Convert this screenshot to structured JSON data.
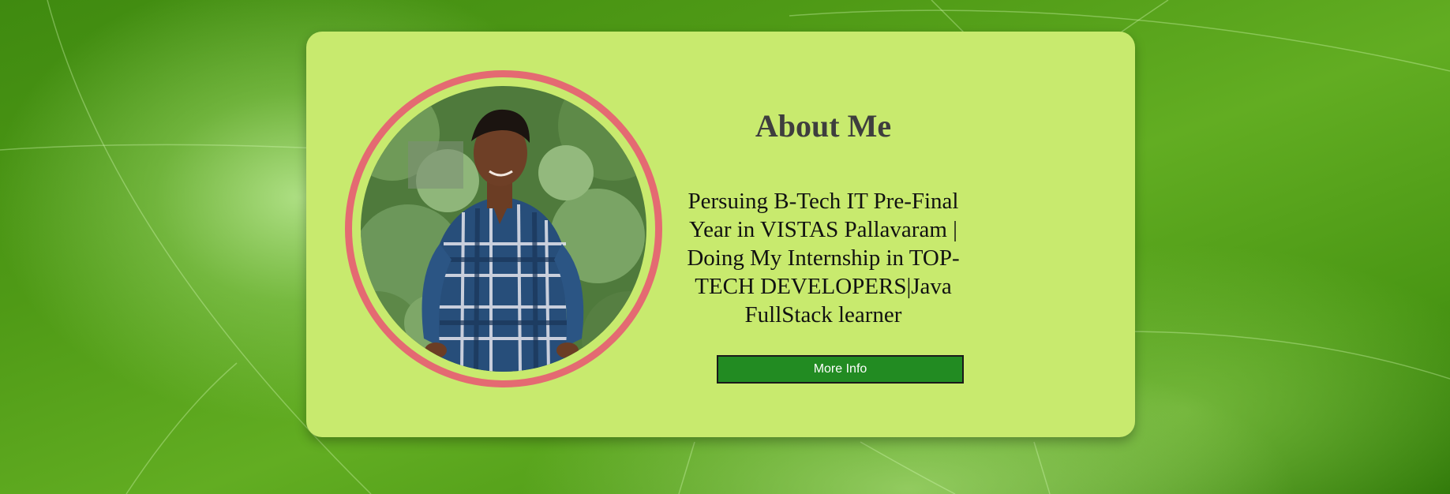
{
  "about": {
    "title": "About Me",
    "bio": "Persuing B-Tech IT Pre-Final Year in VISTAS Pallavaram | Doing My Internship in TOP-TECH DEVELOPERS|Java FullStack learner",
    "more_button_label": "More Info"
  },
  "profile_photo": {
    "icon": "profile-photo",
    "alt": ""
  },
  "colors": {
    "card_background": "#c8ea6e",
    "photo_ring": "#e46a72",
    "button_background": "#228b22",
    "button_text": "#ffffff",
    "title_text": "#3e3e3e"
  }
}
